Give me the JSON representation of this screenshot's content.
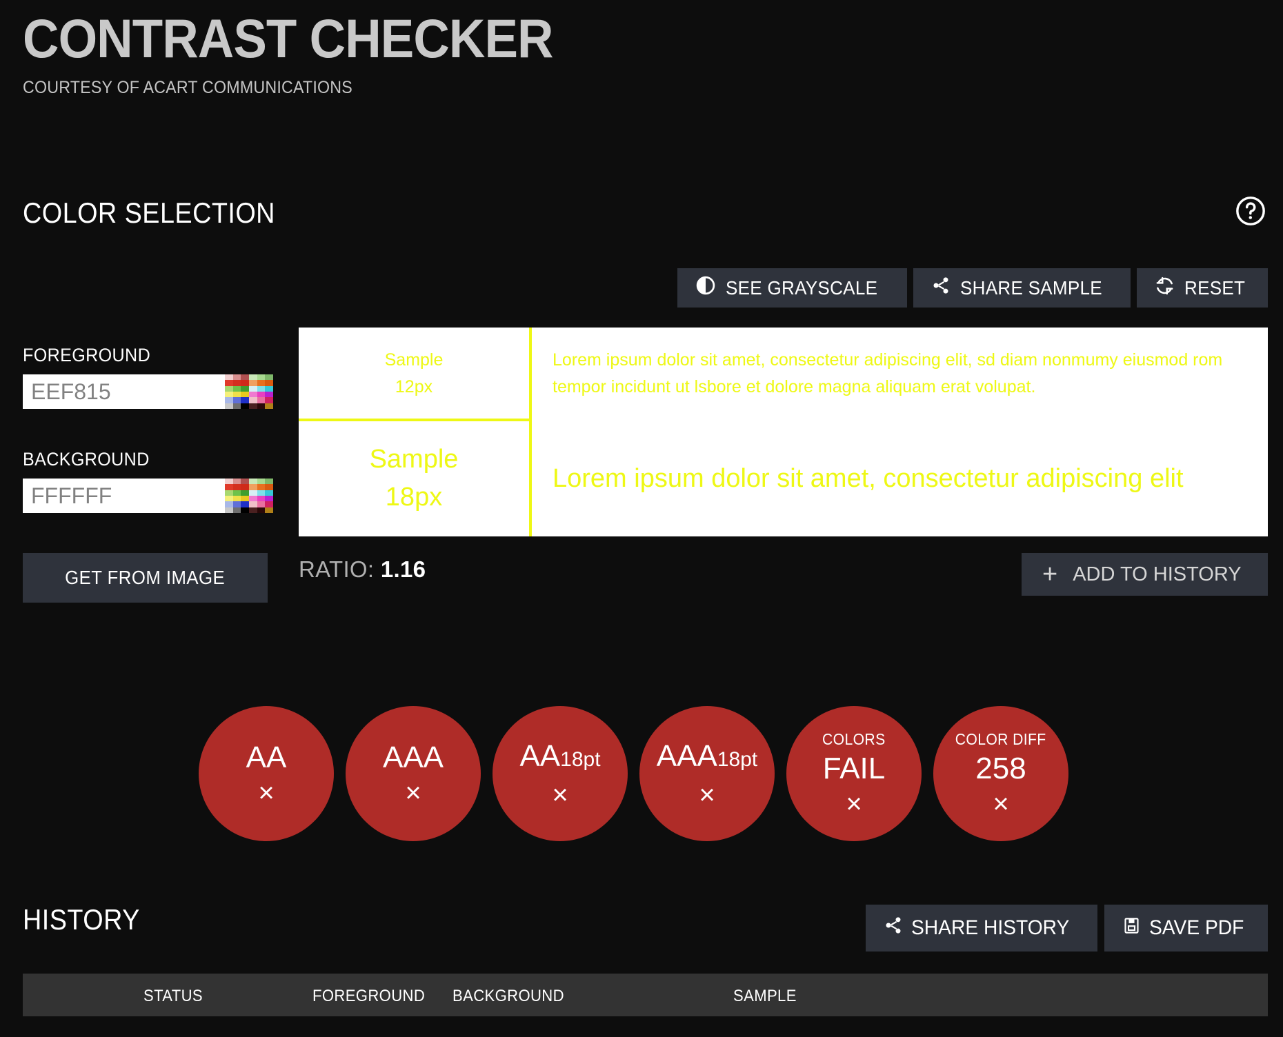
{
  "app": {
    "title": "CONTRAST CHECKER",
    "subtitle": "COURTESY OF ACART COMMUNICATIONS"
  },
  "color_selection": {
    "heading": "COLOR SELECTION",
    "help_icon": "help-circle-icon",
    "toolbar": [
      {
        "label": "SEE GRAYSCALE",
        "icon": "contrast-icon"
      },
      {
        "label": "SHARE SAMPLE",
        "icon": "share-nodes-icon"
      },
      {
        "label": "RESET",
        "icon": "refresh-icon"
      }
    ],
    "foreground": {
      "label": "FOREGROUND",
      "value": "EEF815",
      "placeholder": "EEF815",
      "swatch_icon": "color-palette-icon"
    },
    "background": {
      "label": "BACKGROUND",
      "value": "FFFFFF",
      "placeholder": "FFFFFF",
      "swatch_icon": "color-palette-icon"
    },
    "get_from_image_label": "GET FROM IMAGE",
    "ratio_label": "RATIO:",
    "ratio_value": "1.16",
    "add_to_history_label": "ADD TO HISTORY",
    "add_to_history_icon": "plus-icon"
  },
  "sample": {
    "fg_color": "#EEF815",
    "bg_color": "#FFFFFF",
    "small": {
      "caption_line1": "Sample",
      "caption_line2": "12px",
      "body": "Lorem ipsum dolor sit amet, consectetur adipiscing elit, sd diam nonmumy eiusmod rom tempor incidunt ut lsbore et dolore magna aliquam erat volupat."
    },
    "large": {
      "caption_line1": "Sample",
      "caption_line2": "18px",
      "body": "Lorem ipsum dolor sit amet, consectetur adipiscing elit"
    }
  },
  "results": {
    "fail_color": "#AF2C28",
    "pass_color": "#3C8C4E",
    "items": [
      {
        "caption": "",
        "main": "AA",
        "sub": "",
        "mark": "×",
        "state": "fail"
      },
      {
        "caption": "",
        "main": "AAA",
        "sub": "",
        "mark": "×",
        "state": "fail"
      },
      {
        "caption": "",
        "main": "AA",
        "sub": "18pt",
        "mark": "×",
        "state": "fail"
      },
      {
        "caption": "",
        "main": "AAA",
        "sub": "18pt",
        "mark": "×",
        "state": "fail"
      },
      {
        "caption": "COLORS",
        "main": "FAIL",
        "sub": "",
        "mark": "×",
        "state": "fail"
      },
      {
        "caption": "COLOR DIFF",
        "main": "258",
        "sub": "",
        "mark": "×",
        "state": "fail"
      }
    ]
  },
  "history": {
    "heading": "HISTORY",
    "actions": [
      {
        "label": "SHARE HISTORY",
        "icon": "share-nodes-icon"
      },
      {
        "label": "SAVE PDF",
        "icon": "save-icon"
      }
    ],
    "columns": [
      "STATUS",
      "FOREGROUND",
      "BACKGROUND",
      "SAMPLE"
    ],
    "rows": []
  },
  "palette": {
    "swatches": [
      "#f2cfcf",
      "#d98f8f",
      "#b05050",
      "#c9e8b8",
      "#a8d98f",
      "#7fb86a",
      "#e03a2a",
      "#d42f1f",
      "#cf2a1a",
      "#f0a060",
      "#e87020",
      "#d95a10",
      "#a8d870",
      "#6fc24a",
      "#3f9e2f",
      "#d8f0f5",
      "#7fe0ea",
      "#35c8d8",
      "#f5f07a",
      "#f0e04a",
      "#e8c820",
      "#f07ad0",
      "#e840c0",
      "#b820d0",
      "#a8b8e8",
      "#6070d8",
      "#2030c8",
      "#f0c0c8",
      "#e870a0",
      "#d02060",
      "#c8c8c8",
      "#6f6f6f",
      "#000000",
      "#4a2020",
      "#2a0808",
      "#b08018"
    ]
  }
}
